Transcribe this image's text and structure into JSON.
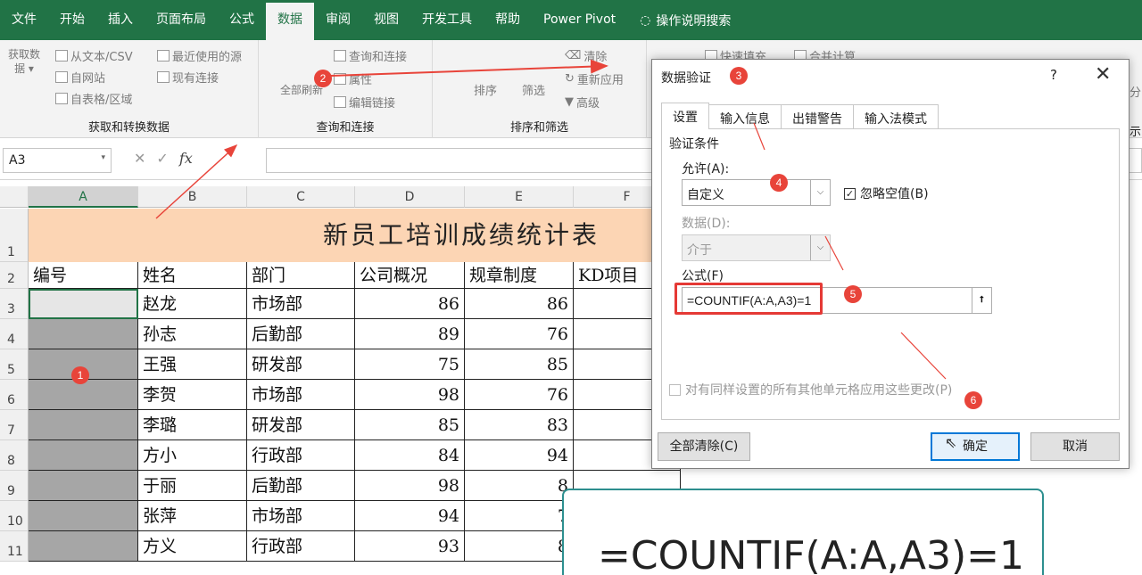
{
  "menu": {
    "tabs": [
      "文件",
      "开始",
      "插入",
      "页面布局",
      "公式",
      "数据",
      "审阅",
      "视图",
      "开发工具",
      "帮助",
      "Power Pivot"
    ],
    "active_index": 5,
    "search": "操作说明搜索"
  },
  "ribbon": {
    "get_data": {
      "big_label": "获取数\n据 ▾",
      "items": [
        "从文本/CSV",
        "自网站",
        "自表格/区域",
        "最近使用的源",
        "现有连接"
      ],
      "group": "获取和转换数据"
    },
    "queries": {
      "big_label": "全部刷新",
      "items": [
        "查询和连接",
        "属性",
        "编辑链接"
      ],
      "group": "查询和连接"
    },
    "sort": {
      "items": [
        "排序",
        "筛选",
        "清除",
        "重新应用",
        "高级"
      ],
      "group": "排序和筛选"
    },
    "tools": {
      "items": [
        "快速填充",
        "合并计算"
      ]
    },
    "right_partial": [
      "分",
      "示"
    ]
  },
  "formula_bar": {
    "name_box": "A3",
    "value": ""
  },
  "sheet": {
    "columns": [
      "A",
      "B",
      "C",
      "D",
      "E",
      "F"
    ],
    "rows": [
      "1",
      "2",
      "3",
      "4",
      "5",
      "6",
      "7",
      "8",
      "9",
      "10",
      "11"
    ],
    "title": "新员工培训成绩统计表",
    "headers": [
      "编号",
      "姓名",
      "部门",
      "公司概况",
      "规章制度",
      "KD项目"
    ],
    "data": [
      [
        "",
        "赵龙",
        "市场部",
        "86",
        "86"
      ],
      [
        "",
        "孙志",
        "后勤部",
        "89",
        "76"
      ],
      [
        "",
        "王强",
        "研发部",
        "75",
        "85"
      ],
      [
        "",
        "李贺",
        "市场部",
        "98",
        "76"
      ],
      [
        "",
        "李璐",
        "研发部",
        "85",
        "83"
      ],
      [
        "",
        "方小",
        "行政部",
        "84",
        "94"
      ],
      [
        "",
        "于丽",
        "后勤部",
        "98",
        "8"
      ],
      [
        "",
        "张萍",
        "市场部",
        "94",
        "7"
      ],
      [
        "",
        "方义",
        "行政部",
        "93",
        "8"
      ]
    ]
  },
  "dialog": {
    "title": "数据验证",
    "help": "?",
    "close": "✕",
    "tabs": [
      "设置",
      "输入信息",
      "出错警告",
      "输入法模式"
    ],
    "section": "验证条件",
    "allow_label": "允许(A):",
    "allow_value": "自定义",
    "ignore_blank": "忽略空值(B)",
    "ignore_blank_checked": true,
    "data_label": "数据(D):",
    "data_value": "介于",
    "formula_label": "公式(F)",
    "formula_value": "=COUNTIF(A:A,A3)=1",
    "apply_all": "对有同样设置的所有其他单元格应用这些更改(P)",
    "clear_all": "全部清除(C)",
    "ok": "确定",
    "cancel": "取消"
  },
  "badges": [
    "1",
    "2",
    "3",
    "4",
    "5",
    "6"
  ],
  "callout_text": "=COUNTIF(A:A,A3)=1",
  "colors": {
    "excel_green": "#217346",
    "title_fill": "#fcd5b4",
    "badge": "#e8443a",
    "arrow": "#e8443a"
  }
}
